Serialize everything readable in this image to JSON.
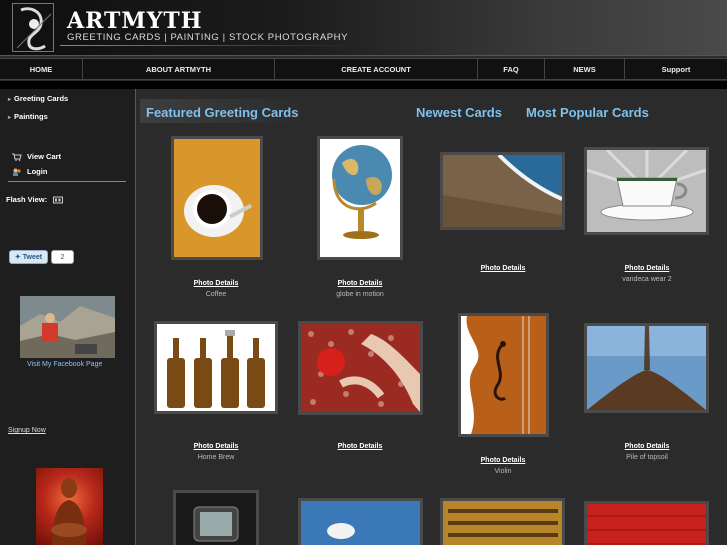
{
  "header": {
    "title": "ARTMYTH",
    "tagline": "GREETING CARDS | PAINTING | STOCK PHOTOGRAPHY"
  },
  "nav": {
    "items": [
      "HOME",
      "ABOUT ARTMYTH",
      "CREATE ACCOUNT",
      "FAQ",
      "NEWS",
      "Support"
    ]
  },
  "sidebar": {
    "links": [
      "Greeting Cards",
      "Paintings"
    ],
    "view_cart": "View Cart",
    "login": "Login",
    "flash_view": "Flash View:",
    "tweet_label": "Tweet",
    "tweet_count": "2",
    "facebook_link": "Visit My Facebook Page",
    "signup": "Signup Now"
  },
  "main": {
    "tabs": [
      "Featured Greeting Cards",
      "Newest Cards",
      "Most Popular Cards"
    ],
    "detail_label": "Photo Details",
    "cards": [
      {
        "caption": "Coffee"
      },
      {
        "caption": "globe in motion"
      },
      {
        "caption": ""
      },
      {
        "caption": "vandeca wear 2"
      },
      {
        "caption": "Home Brew"
      },
      {
        "caption": ""
      },
      {
        "caption": "Violin"
      },
      {
        "caption": "Pile of topsoil"
      }
    ]
  },
  "colors": {
    "accent": "#7fc0ee",
    "background": "#2b2b2b",
    "sidebar": "#1e1e1e"
  }
}
